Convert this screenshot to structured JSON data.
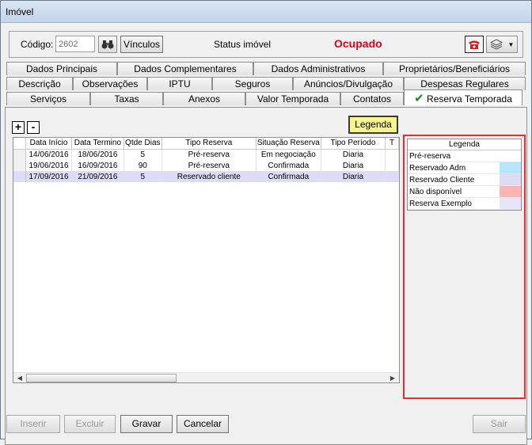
{
  "window": {
    "title": "Imóvel"
  },
  "header": {
    "codigo_label": "Código:",
    "codigo_value": "2602",
    "vinculos_label": "Vínculos",
    "status_label": "Status imóvel",
    "status_value": "Ocupado",
    "status_color": "#e0001a"
  },
  "tabs": {
    "row1": [
      "Dados Principais",
      "Dados Complementares",
      "Dados Administrativos",
      "Proprietários/Beneficiários"
    ],
    "row2": [
      "Descrição",
      "Observações",
      "IPTU",
      "Seguros",
      "Anúncios/Divulgação",
      "Despesas Regulares"
    ],
    "row3": [
      "Serviços",
      "Taxas",
      "Anexos",
      "Valor Temporada",
      "Contatos",
      "Reserva Temporada"
    ],
    "active": "Reserva Temporada"
  },
  "toolbar": {
    "add": "+",
    "remove": "-",
    "legenda": "Legenda"
  },
  "grid": {
    "columns": [
      "Data Início",
      "Data Termino",
      "Qtde Dias",
      "Tipo Reserva",
      "Situação Reserva",
      "Tipo Período",
      "T"
    ],
    "rows": [
      [
        "14/06/2016",
        "18/06/2016",
        "5",
        "Pré-reserva",
        "Em negociação",
        "Diaria"
      ],
      [
        "19/06/2016",
        "16/09/2016",
        "90",
        "Pré-reserva",
        "Confirmada",
        "Diaria"
      ],
      [
        "17/09/2016",
        "21/09/2016",
        "5",
        "Reservado cliente",
        "Confirmada",
        "Diaria"
      ]
    ]
  },
  "legend": {
    "title": "Legenda",
    "items": [
      {
        "name": "Pré-reserva",
        "color": "#ffffff"
      },
      {
        "name": "Reservado Adm",
        "color": "#b5e6ff"
      },
      {
        "name": "Reservado Cliente",
        "color": "#dcdcf7"
      },
      {
        "name": "Não disponível",
        "color": "#ffb3b3"
      },
      {
        "name": "Reserva Exemplo",
        "color": "#e6e6fa"
      }
    ]
  },
  "footer": {
    "inserir": "Inserir",
    "excluir": "Excluir",
    "gravar": "Gravar",
    "cancelar": "Cancelar",
    "sair": "Sair"
  }
}
